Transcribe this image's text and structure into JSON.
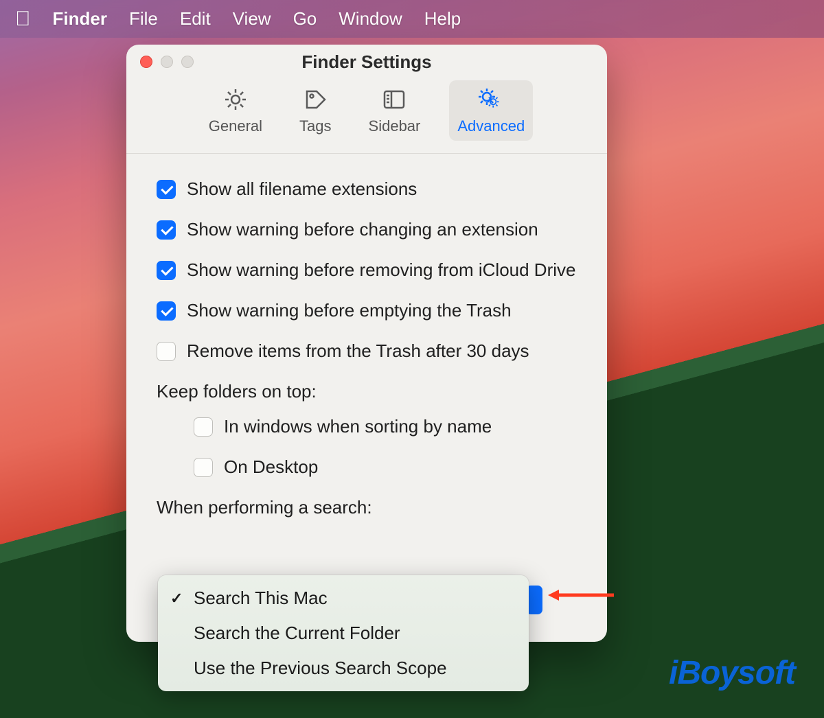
{
  "menubar": {
    "items": [
      "Finder",
      "File",
      "Edit",
      "View",
      "Go",
      "Window",
      "Help"
    ],
    "active_index": 0
  },
  "window": {
    "title": "Finder Settings",
    "tabs": [
      {
        "label": "General",
        "icon": "gear"
      },
      {
        "label": "Tags",
        "icon": "tag"
      },
      {
        "label": "Sidebar",
        "icon": "sidebar"
      },
      {
        "label": "Advanced",
        "icon": "gear-double",
        "selected": true
      }
    ],
    "checkboxes": [
      {
        "label": "Show all filename extensions",
        "checked": true
      },
      {
        "label": "Show warning before changing an extension",
        "checked": true
      },
      {
        "label": "Show warning before removing from iCloud Drive",
        "checked": true
      },
      {
        "label": "Show warning before emptying the Trash",
        "checked": true
      },
      {
        "label": "Remove items from the Trash after 30 days",
        "checked": false
      }
    ],
    "keep_folders_label": "Keep folders on top:",
    "keep_folders_options": [
      {
        "label": "In windows when sorting by name",
        "checked": false
      },
      {
        "label": "On Desktop",
        "checked": false
      }
    ],
    "search_label": "When performing a search:",
    "search_dropdown": {
      "selected_index": 0,
      "options": [
        "Search This Mac",
        "Search the Current Folder",
        "Use the Previous Search Scope"
      ]
    }
  },
  "watermark": "iBoysoft"
}
